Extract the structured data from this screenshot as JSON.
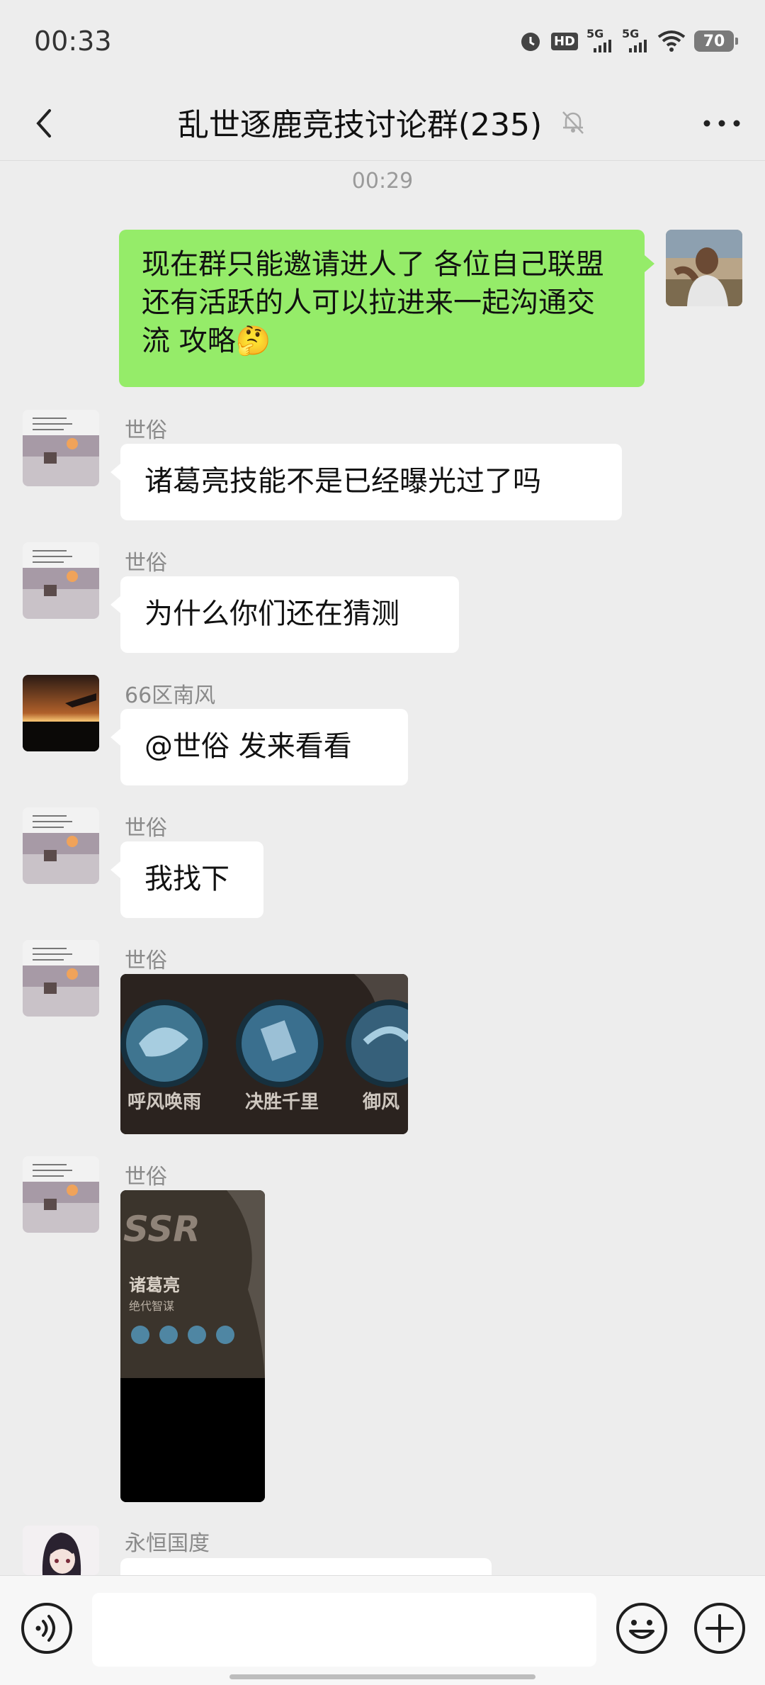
{
  "status_bar": {
    "time": "00:33",
    "battery": "70",
    "hd_label": "HD",
    "net1_label": "5G",
    "net2_label": "5G"
  },
  "header": {
    "title": "乱世逐鹿竞技讨论群(235)"
  },
  "chat": {
    "timestamp": "00:29",
    "messages": [
      {
        "sender": "",
        "text": "现在群只能邀请进人了 各位自己联盟还有活跃的人可以拉进来一起沟通交流 攻略🤔",
        "mine": true
      },
      {
        "sender": "世俗",
        "text": "诸葛亮技能不是已经曝光过了吗"
      },
      {
        "sender": "世俗",
        "text": "为什么你们还在猜测"
      },
      {
        "sender": "66区南风",
        "text": "@世俗  发来看看"
      },
      {
        "sender": "世俗",
        "text": "我找下"
      },
      {
        "sender": "世俗",
        "text": "",
        "image": {
          "skill_labels": [
            "呼风唤雨",
            "决胜千里",
            "御风"
          ]
        }
      },
      {
        "sender": "世俗",
        "text": "",
        "image": {
          "rarity": "SSR",
          "hero_name": "诸葛亮",
          "subtitle": "绝代智谋"
        }
      },
      {
        "sender": "永恒国度",
        "text": ""
      }
    ]
  },
  "colors": {
    "bg": "#ededed",
    "my_bubble": "#95ec69",
    "other_bubble": "#ffffff"
  }
}
